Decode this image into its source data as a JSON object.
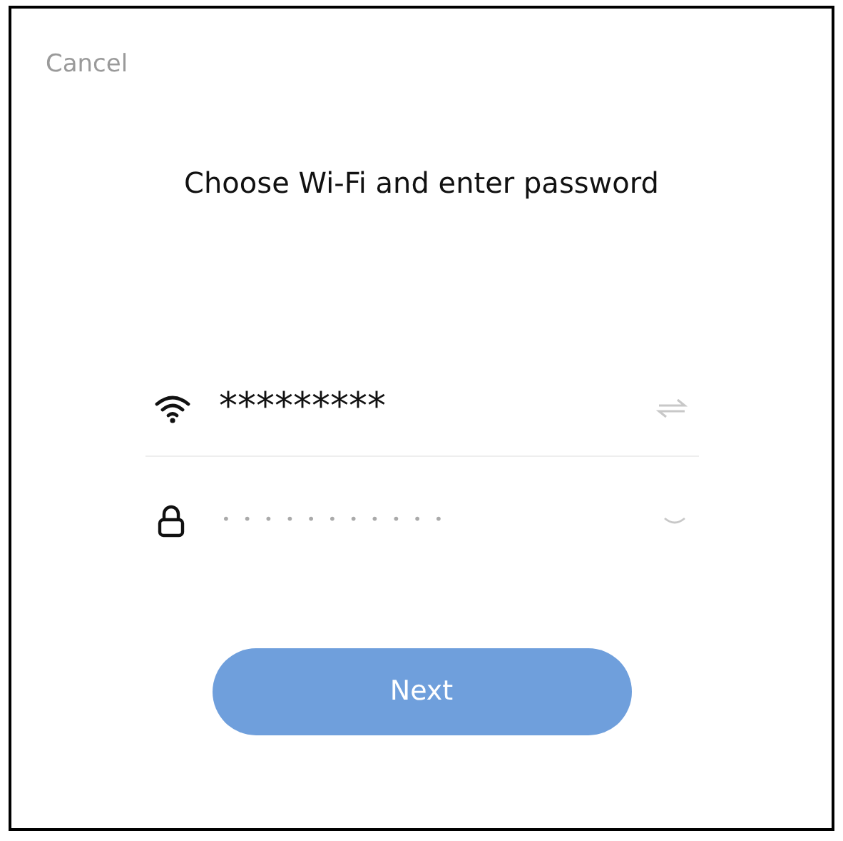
{
  "cancel": "Cancel",
  "title": "Choose Wi-Fi and enter password",
  "network": {
    "value": "*********"
  },
  "password": {
    "value": "•••••••••••"
  },
  "next_button": "Next"
}
